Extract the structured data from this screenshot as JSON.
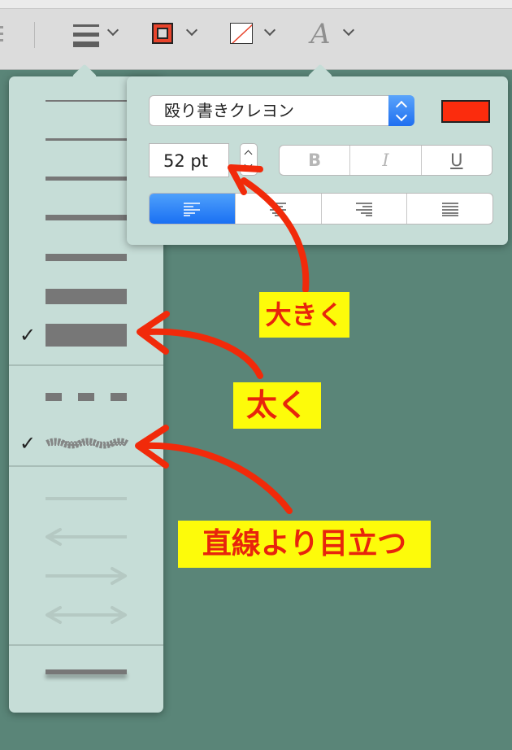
{
  "toolbar": {
    "icons": [
      "line-style-icon",
      "stroke-color-icon",
      "fill-color-icon",
      "text-format-icon"
    ],
    "stroke_color": "#e8442c",
    "font_icon_glyph": "A"
  },
  "line_panel": {
    "selected_thickness_index": 6,
    "check_mark": "✓",
    "styles": [
      "solid",
      "dashed",
      "crayon"
    ],
    "selected_style": "crayon",
    "arrow_styles": [
      "none",
      "left-arrow",
      "right-arrow",
      "double-arrow"
    ]
  },
  "format_panel": {
    "font_name": "殴り書きクレヨン",
    "text_color": "#fb2c0d",
    "font_size": "52 pt",
    "style_buttons": {
      "bold": "B",
      "italic": "I",
      "underline": "U"
    },
    "alignment_options": [
      "left",
      "center",
      "right",
      "justify"
    ],
    "selected_alignment": "left"
  },
  "annotations": {
    "bigger": "大きく",
    "thicker": "太く",
    "stands_out": "直線より目立つ",
    "text_color": "#e8240c",
    "highlight_color": "#fdfb0a"
  }
}
